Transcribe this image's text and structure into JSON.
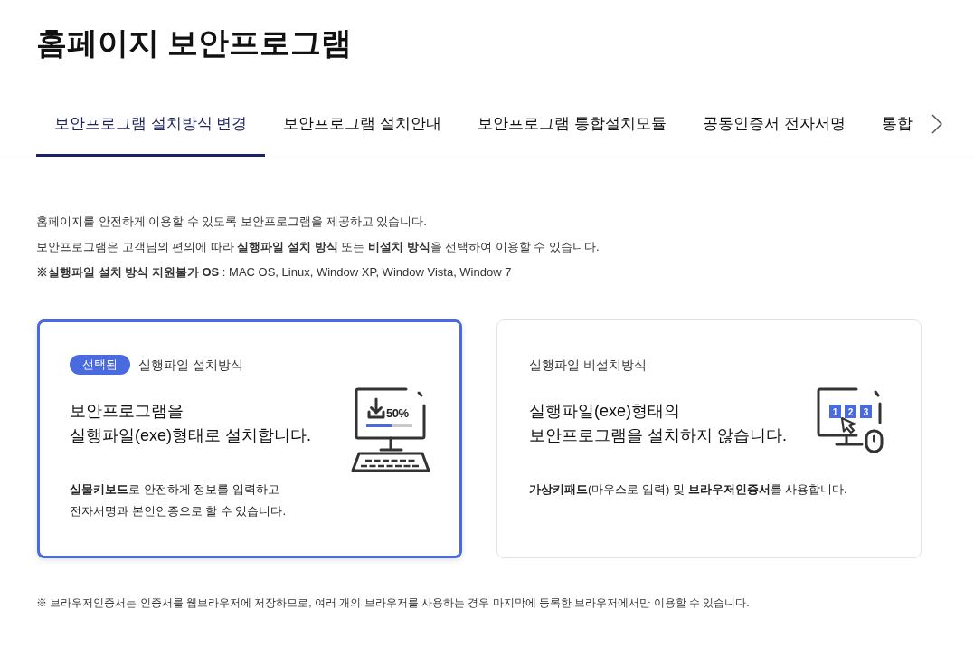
{
  "page": {
    "title": "홈페이지 보안프로그램"
  },
  "tabs": [
    {
      "label": "보안프로그램 설치방식 변경",
      "selected": true
    },
    {
      "label": "보안프로그램 설치안내",
      "selected": false
    },
    {
      "label": "보안프로그램 통합설치모듈",
      "selected": false
    },
    {
      "label": "공동인증서 전자서명",
      "selected": false
    },
    {
      "label": "통합",
      "selected": false
    }
  ],
  "intro": [
    "홈페이지를 안전하게 이용할 수 있도록 보안프로그램을 제공하고 있습니다.",
    "보안프로그램은 고객님의 편의에 따라 **실행파일 설치 방식** 또는 **비설치 방식**을 선택하여 이용할 수 있습니다.",
    "**※실행파일 설치 방식 지원불가 OS** : MAC OS, Linux, Window XP, Window Vista, Window 7"
  ],
  "options": [
    {
      "selected": true,
      "badge": "선택됨",
      "label": "실행파일 설치방식",
      "title": [
        "보안프로그램을",
        "실행파일(exe)형태로 설치합니다."
      ],
      "description": [
        "**실물키보드**로 안전하게 정보를 입력하고",
        "전자서명과 본인인증으로 할 수 있습니다."
      ],
      "illustration": {
        "kind": "download",
        "text": "50%",
        "level": 0.55
      }
    },
    {
      "selected": false,
      "label": "실행파일 비설치방식",
      "title": [
        "실행파일(exe)형태의",
        "보안프로그램을 설치하지 않습니다."
      ],
      "description": [
        "**가상키패드**(마우스로 입력) 및 **브라우저인증서**를 사용합니다."
      ],
      "illustration": {
        "kind": "keypad",
        "keys": [
          "1",
          "2",
          "3"
        ]
      }
    }
  ],
  "footnote": "※ 브라우저인증서는 인증서를 웹브라우저에 저장하므로, 여러 개의 브라우저를 사용하는 경우 마지막에 등록한 브라우저에서만 이용할 수 있습니다."
}
